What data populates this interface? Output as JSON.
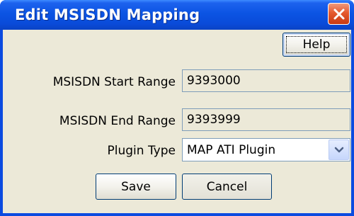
{
  "window": {
    "title": "Edit MSISDN Mapping"
  },
  "buttons": {
    "help": "Help",
    "save": "Save",
    "cancel": "Cancel"
  },
  "form": {
    "start_range_label": "MSISDN Start Range",
    "start_range_value": "9393000",
    "end_range_label": "MSISDN End Range",
    "end_range_value": "9393999",
    "plugin_type_label": "Plugin Type",
    "plugin_type_value": "MAP ATI Plugin"
  },
  "icons": {
    "close": "close-icon",
    "dropdown": "chevron-down-icon"
  },
  "colors": {
    "titlebar": "#0b54e3",
    "close_button": "#e55a2f",
    "dialog_bg": "#ece9d8"
  }
}
